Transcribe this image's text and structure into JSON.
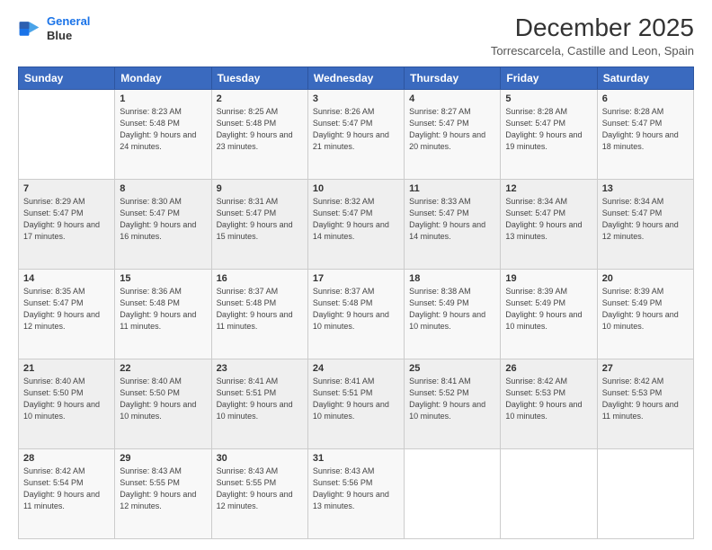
{
  "logo": {
    "line1": "General",
    "line2": "Blue"
  },
  "header": {
    "month": "December 2025",
    "location": "Torrescarcela, Castille and Leon, Spain"
  },
  "weekdays": [
    "Sunday",
    "Monday",
    "Tuesday",
    "Wednesday",
    "Thursday",
    "Friday",
    "Saturday"
  ],
  "weeks": [
    [
      {
        "day": "",
        "sunrise": "",
        "sunset": "",
        "daylight": ""
      },
      {
        "day": "1",
        "sunrise": "Sunrise: 8:23 AM",
        "sunset": "Sunset: 5:48 PM",
        "daylight": "Daylight: 9 hours and 24 minutes."
      },
      {
        "day": "2",
        "sunrise": "Sunrise: 8:25 AM",
        "sunset": "Sunset: 5:48 PM",
        "daylight": "Daylight: 9 hours and 23 minutes."
      },
      {
        "day": "3",
        "sunrise": "Sunrise: 8:26 AM",
        "sunset": "Sunset: 5:47 PM",
        "daylight": "Daylight: 9 hours and 21 minutes."
      },
      {
        "day": "4",
        "sunrise": "Sunrise: 8:27 AM",
        "sunset": "Sunset: 5:47 PM",
        "daylight": "Daylight: 9 hours and 20 minutes."
      },
      {
        "day": "5",
        "sunrise": "Sunrise: 8:28 AM",
        "sunset": "Sunset: 5:47 PM",
        "daylight": "Daylight: 9 hours and 19 minutes."
      },
      {
        "day": "6",
        "sunrise": "Sunrise: 8:28 AM",
        "sunset": "Sunset: 5:47 PM",
        "daylight": "Daylight: 9 hours and 18 minutes."
      }
    ],
    [
      {
        "day": "7",
        "sunrise": "Sunrise: 8:29 AM",
        "sunset": "Sunset: 5:47 PM",
        "daylight": "Daylight: 9 hours and 17 minutes."
      },
      {
        "day": "8",
        "sunrise": "Sunrise: 8:30 AM",
        "sunset": "Sunset: 5:47 PM",
        "daylight": "Daylight: 9 hours and 16 minutes."
      },
      {
        "day": "9",
        "sunrise": "Sunrise: 8:31 AM",
        "sunset": "Sunset: 5:47 PM",
        "daylight": "Daylight: 9 hours and 15 minutes."
      },
      {
        "day": "10",
        "sunrise": "Sunrise: 8:32 AM",
        "sunset": "Sunset: 5:47 PM",
        "daylight": "Daylight: 9 hours and 14 minutes."
      },
      {
        "day": "11",
        "sunrise": "Sunrise: 8:33 AM",
        "sunset": "Sunset: 5:47 PM",
        "daylight": "Daylight: 9 hours and 14 minutes."
      },
      {
        "day": "12",
        "sunrise": "Sunrise: 8:34 AM",
        "sunset": "Sunset: 5:47 PM",
        "daylight": "Daylight: 9 hours and 13 minutes."
      },
      {
        "day": "13",
        "sunrise": "Sunrise: 8:34 AM",
        "sunset": "Sunset: 5:47 PM",
        "daylight": "Daylight: 9 hours and 12 minutes."
      }
    ],
    [
      {
        "day": "14",
        "sunrise": "Sunrise: 8:35 AM",
        "sunset": "Sunset: 5:47 PM",
        "daylight": "Daylight: 9 hours and 12 minutes."
      },
      {
        "day": "15",
        "sunrise": "Sunrise: 8:36 AM",
        "sunset": "Sunset: 5:48 PM",
        "daylight": "Daylight: 9 hours and 11 minutes."
      },
      {
        "day": "16",
        "sunrise": "Sunrise: 8:37 AM",
        "sunset": "Sunset: 5:48 PM",
        "daylight": "Daylight: 9 hours and 11 minutes."
      },
      {
        "day": "17",
        "sunrise": "Sunrise: 8:37 AM",
        "sunset": "Sunset: 5:48 PM",
        "daylight": "Daylight: 9 hours and 10 minutes."
      },
      {
        "day": "18",
        "sunrise": "Sunrise: 8:38 AM",
        "sunset": "Sunset: 5:49 PM",
        "daylight": "Daylight: 9 hours and 10 minutes."
      },
      {
        "day": "19",
        "sunrise": "Sunrise: 8:39 AM",
        "sunset": "Sunset: 5:49 PM",
        "daylight": "Daylight: 9 hours and 10 minutes."
      },
      {
        "day": "20",
        "sunrise": "Sunrise: 8:39 AM",
        "sunset": "Sunset: 5:49 PM",
        "daylight": "Daylight: 9 hours and 10 minutes."
      }
    ],
    [
      {
        "day": "21",
        "sunrise": "Sunrise: 8:40 AM",
        "sunset": "Sunset: 5:50 PM",
        "daylight": "Daylight: 9 hours and 10 minutes."
      },
      {
        "day": "22",
        "sunrise": "Sunrise: 8:40 AM",
        "sunset": "Sunset: 5:50 PM",
        "daylight": "Daylight: 9 hours and 10 minutes."
      },
      {
        "day": "23",
        "sunrise": "Sunrise: 8:41 AM",
        "sunset": "Sunset: 5:51 PM",
        "daylight": "Daylight: 9 hours and 10 minutes."
      },
      {
        "day": "24",
        "sunrise": "Sunrise: 8:41 AM",
        "sunset": "Sunset: 5:51 PM",
        "daylight": "Daylight: 9 hours and 10 minutes."
      },
      {
        "day": "25",
        "sunrise": "Sunrise: 8:41 AM",
        "sunset": "Sunset: 5:52 PM",
        "daylight": "Daylight: 9 hours and 10 minutes."
      },
      {
        "day": "26",
        "sunrise": "Sunrise: 8:42 AM",
        "sunset": "Sunset: 5:53 PM",
        "daylight": "Daylight: 9 hours and 10 minutes."
      },
      {
        "day": "27",
        "sunrise": "Sunrise: 8:42 AM",
        "sunset": "Sunset: 5:53 PM",
        "daylight": "Daylight: 9 hours and 11 minutes."
      }
    ],
    [
      {
        "day": "28",
        "sunrise": "Sunrise: 8:42 AM",
        "sunset": "Sunset: 5:54 PM",
        "daylight": "Daylight: 9 hours and 11 minutes."
      },
      {
        "day": "29",
        "sunrise": "Sunrise: 8:43 AM",
        "sunset": "Sunset: 5:55 PM",
        "daylight": "Daylight: 9 hours and 12 minutes."
      },
      {
        "day": "30",
        "sunrise": "Sunrise: 8:43 AM",
        "sunset": "Sunset: 5:55 PM",
        "daylight": "Daylight: 9 hours and 12 minutes."
      },
      {
        "day": "31",
        "sunrise": "Sunrise: 8:43 AM",
        "sunset": "Sunset: 5:56 PM",
        "daylight": "Daylight: 9 hours and 13 minutes."
      },
      {
        "day": "",
        "sunrise": "",
        "sunset": "",
        "daylight": ""
      },
      {
        "day": "",
        "sunrise": "",
        "sunset": "",
        "daylight": ""
      },
      {
        "day": "",
        "sunrise": "",
        "sunset": "",
        "daylight": ""
      }
    ]
  ]
}
